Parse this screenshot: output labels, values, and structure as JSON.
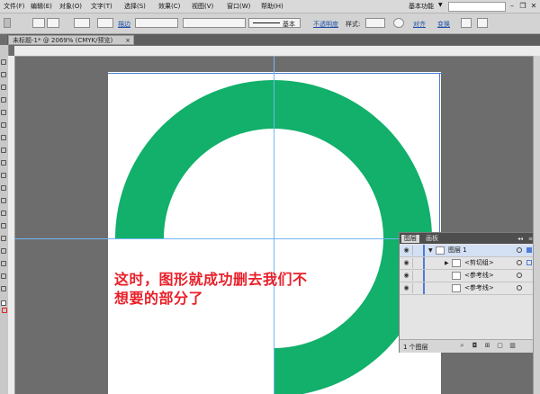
{
  "menu": {
    "items": [
      "文件(F)",
      "编辑(E)",
      "对象(O)",
      "文字(T)",
      "选择(S)",
      "效果(C)",
      "视图(V)",
      "窗口(W)",
      "帮助(H)"
    ],
    "workspace": "基本功能",
    "minimize": "–",
    "restore": "❐",
    "close": "✕"
  },
  "control_bar": {
    "stroke_label": "描边",
    "style_line_label": "基本",
    "opacity_label": "不透明度",
    "style_label": "样式:",
    "align_label": "对齐",
    "transform_label": "变换"
  },
  "document": {
    "tab_title": "未标题-1* @ 2069% (CMYK/预览)",
    "tab_close": "×"
  },
  "artwork": {
    "ring_color": "#12b06a",
    "guide_color": "#74b7f5"
  },
  "annotation": {
    "line1": "这时，图形就成功删去我们不",
    "line2": "想要的部分了",
    "color": "#e8202a"
  },
  "layers_panel": {
    "tabs": [
      "图层",
      "画板"
    ],
    "rows": [
      {
        "name": "图层 1",
        "expanded": true
      },
      {
        "name": "<剪切组>",
        "expanded": false
      },
      {
        "name": "<参考线>",
        "expanded": false
      },
      {
        "name": "<参考线>",
        "expanded": false
      }
    ],
    "footer_count": "1 个图层"
  }
}
